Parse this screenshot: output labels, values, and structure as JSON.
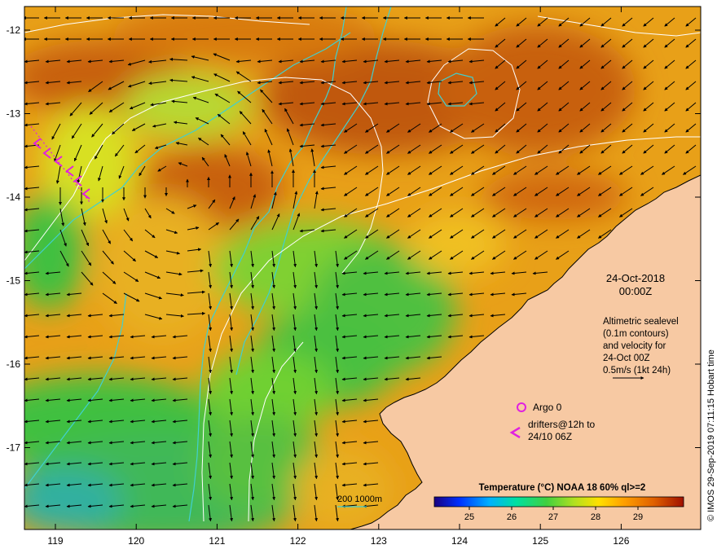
{
  "map": {
    "date_label": "24-Oct-2018",
    "time_label": "00:00Z",
    "info_lines": [
      "Altimetric sealevel",
      "(0.1m contours)",
      "and velocity for",
      "24-Oct 00Z"
    ],
    "velocity_scale_label": "0.5m/s (1kt 24h)",
    "argo_label": "Argo 0",
    "drifter_line1": "drifters@12h to",
    "drifter_line2": "24/10 06Z",
    "bathy_label": "200  1000m",
    "credit": "© IMOS 29-Sep-2019 07:11:15 Hobart time"
  },
  "axes": {
    "lon_ticks": [
      "119",
      "120",
      "121",
      "122",
      "123",
      "124",
      "125",
      "126"
    ],
    "lat_ticks": [
      "-12",
      "-13",
      "-14",
      "-15",
      "-16",
      "-17"
    ]
  },
  "colorbar": {
    "title": "Temperature (°C) NOAA 18 60% ql>=2",
    "ticks": [
      "25",
      "26",
      "27",
      "28",
      "29"
    ],
    "colors": [
      "#1a0080",
      "#0030ff",
      "#00b0ff",
      "#00e0a0",
      "#40d040",
      "#b0e020",
      "#ffe000",
      "#ffa000",
      "#e06000",
      "#a01000"
    ]
  },
  "colors": {
    "land": "#f7c9a3",
    "sea_warm": "#e8a018",
    "sea_hot": "#c86010",
    "sea_mid": "#f0c020",
    "sea_cool": "#50c040",
    "sea_cold": "#30b0a0",
    "bathy_line": "#40d0d0",
    "contour": "#ffffff",
    "marker": "#e020e0"
  }
}
